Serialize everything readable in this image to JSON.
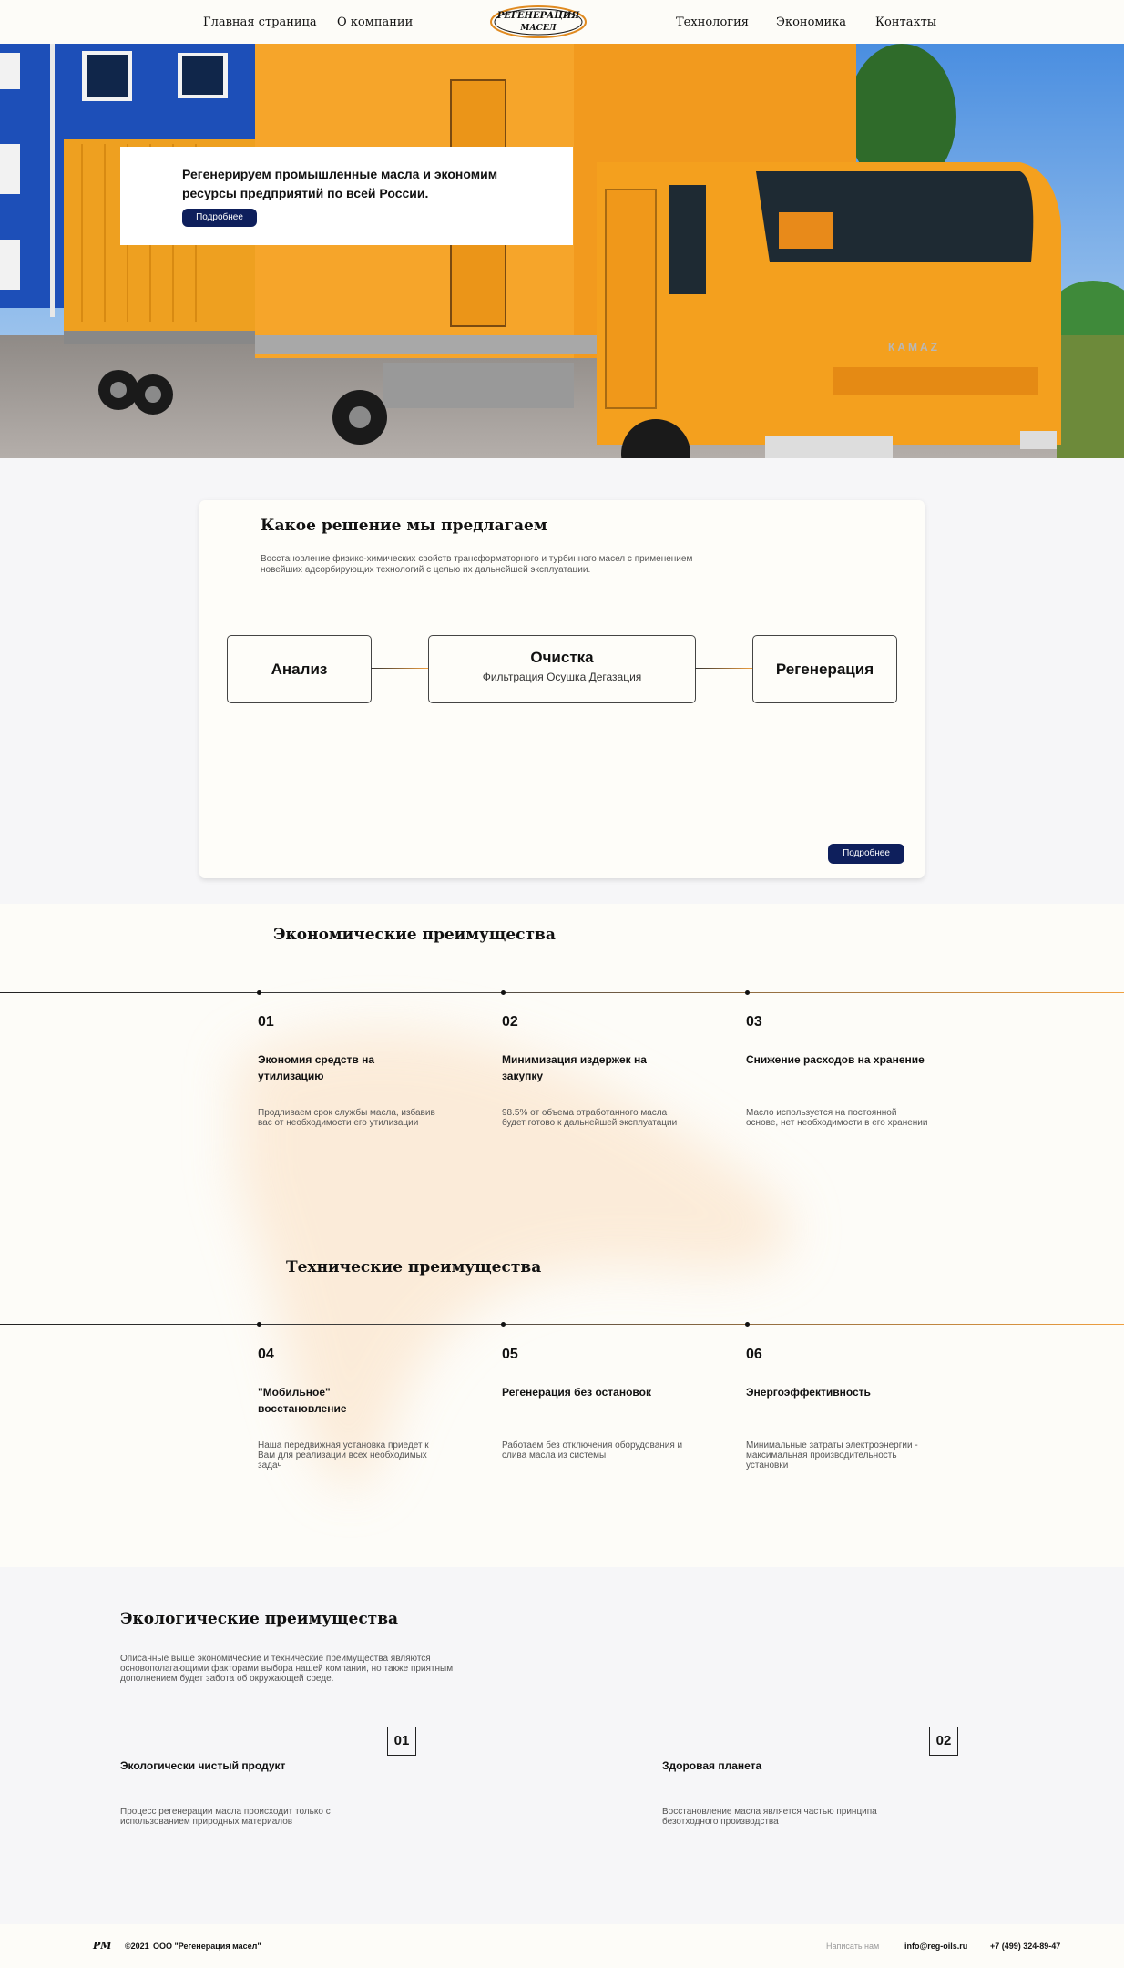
{
  "nav": {
    "left": [
      "Главная страница",
      "О компании"
    ],
    "right": [
      "Технология",
      "Экономика",
      "Контакты"
    ],
    "logo_line1": "РЕГЕНЕРАЦИЯ",
    "logo_line2": "МАСЕЛ"
  },
  "hero": {
    "text": "Регенерируем промышленные масла и экономим ресурсы предприятий по всей России.",
    "button": "Подробнее",
    "truck_brand": "КАМАZ"
  },
  "solution": {
    "title": "Какое решение мы предлагаем",
    "description": "Восстановление физико-химических свойств трансформаторного и турбинного масел с применением новейших адсорбирующих технологий с целью их дальнейшей эксплуатации.",
    "steps": [
      {
        "title": "Анализ",
        "subtitle": ""
      },
      {
        "title": "Очистка",
        "subtitle": "Фильтрация Осушка Дегазация"
      },
      {
        "title": "Регенерация",
        "subtitle": ""
      }
    ],
    "button": "Подробнее"
  },
  "economic": {
    "title": "Экономические преимущества",
    "items": [
      {
        "num": "01",
        "title": "Экономия средств на утилизацию",
        "text": "Продливаем срок службы масла, избавив вас от необходимости его утилизации"
      },
      {
        "num": "02",
        "title": "Минимизация издержек на закупку",
        "text": "98.5% от объема отработанного масла будет готово к дальнейшей эксплуатации"
      },
      {
        "num": "03",
        "title": "Снижение расходов на хранение",
        "text": "Масло используется на постоянной основе, нет необходимости в его хранении"
      }
    ]
  },
  "technical": {
    "title": "Технические преимущества",
    "items": [
      {
        "num": "04",
        "title": "\"Мобильное\" восстановление",
        "text": "Наша передвижная установка приедет к Вам для реализации всех необходимых задач"
      },
      {
        "num": "05",
        "title": "Регенерация без остановок",
        "text": "Работаем без отключения оборудования и слива масла из системы"
      },
      {
        "num": "06",
        "title": "Энергоэффективность",
        "text": "Минимальные затраты электроэнергии - максимальная производительность установки"
      }
    ]
  },
  "ecological": {
    "title": "Экологические преимущества",
    "description": "Описанные выше экономические и технические преимущества являются основополагающими факторами выбора нашей компании, но также приятным дополнением будет забота об окружающей среде.",
    "items": [
      {
        "num": "01",
        "title": "Экологически чистый продукт",
        "text": "Процесс регенерации масла происходит только с использованием природных материалов"
      },
      {
        "num": "02",
        "title": "Здоровая планета",
        "text": "Восстановление масла является частью принципа безотходного производства"
      }
    ]
  },
  "footer": {
    "logo": "РМ",
    "copyright": "©2021",
    "company": "ООО \"Регенерация масел\"",
    "write_us": "Написать нам",
    "email": "info@reg-oils.ru",
    "phone": "+7 (499) 324-89-47"
  },
  "colors": {
    "accent": "#f0a040",
    "button": "#0e1f5c",
    "truck": "#f39a1a"
  }
}
